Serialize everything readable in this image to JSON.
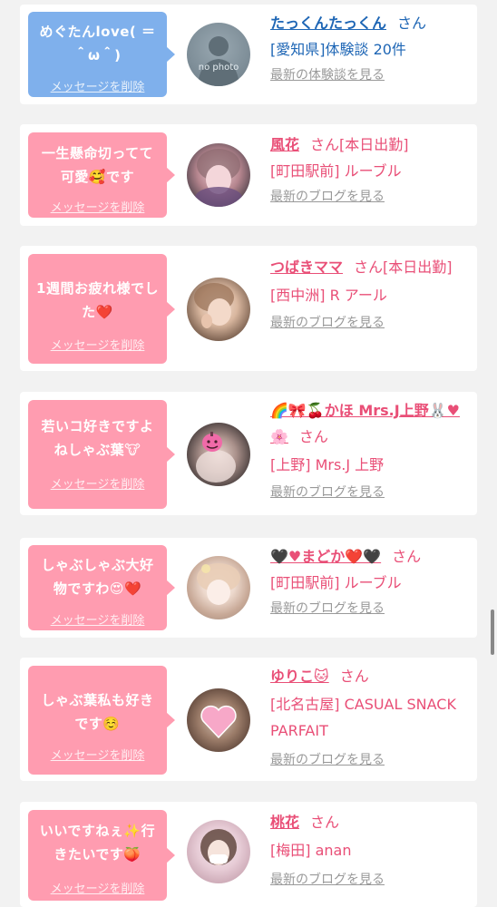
{
  "delete_label": "メッセージを削除",
  "items": [
    {
      "message": "めぐたんlove( ＝＾ω＾)",
      "name": "たっくんたっくん",
      "san": "さん",
      "detail": "[愛知県]体験談 20件",
      "link": "最新の体験談を見る",
      "avatar_text": "no photo",
      "color": "blue"
    },
    {
      "message": "一生懸命切ってて可愛🥰です",
      "name": "風花",
      "san": "さん[本日出勤]",
      "detail": "[町田駅前] ルーブル",
      "link": "最新のブログを見る",
      "color": "pink"
    },
    {
      "message": "1週間お疲れ様でした❤️",
      "name": "つばきママ",
      "san": "さん[本日出勤]",
      "detail": "[西中洲] R アール",
      "link": "最新のブログを見る",
      "color": "pink"
    },
    {
      "message": "若いコ好きですよねしゃぶ葉🐮",
      "name": "🌈🎀🍒かほ Mrs.J上野🐰♥🌸",
      "san": "さん",
      "detail": "[上野] Mrs.J 上野",
      "link": "最新のブログを見る",
      "color": "pink"
    },
    {
      "message": "しゃぶしゃぶ大好物ですわ😍❤️",
      "name": "🖤♥まどか❤️🖤",
      "san": "さん",
      "detail": "[町田駅前] ルーブル",
      "link": "最新のブログを見る",
      "color": "pink"
    },
    {
      "message": "しゃぶ葉私も好きです☺️",
      "name": "ゆりこ🐱",
      "san": "さん",
      "detail": "[北名古屋] CASUAL SNACK PARFAIT",
      "link": "最新のブログを見る",
      "color": "pink"
    },
    {
      "message": "いいですねぇ✨行きたいです🍑",
      "name": "桃花",
      "san": "さん",
      "detail": "[梅田] anan",
      "link": "最新のブログを見る",
      "color": "pink"
    }
  ]
}
